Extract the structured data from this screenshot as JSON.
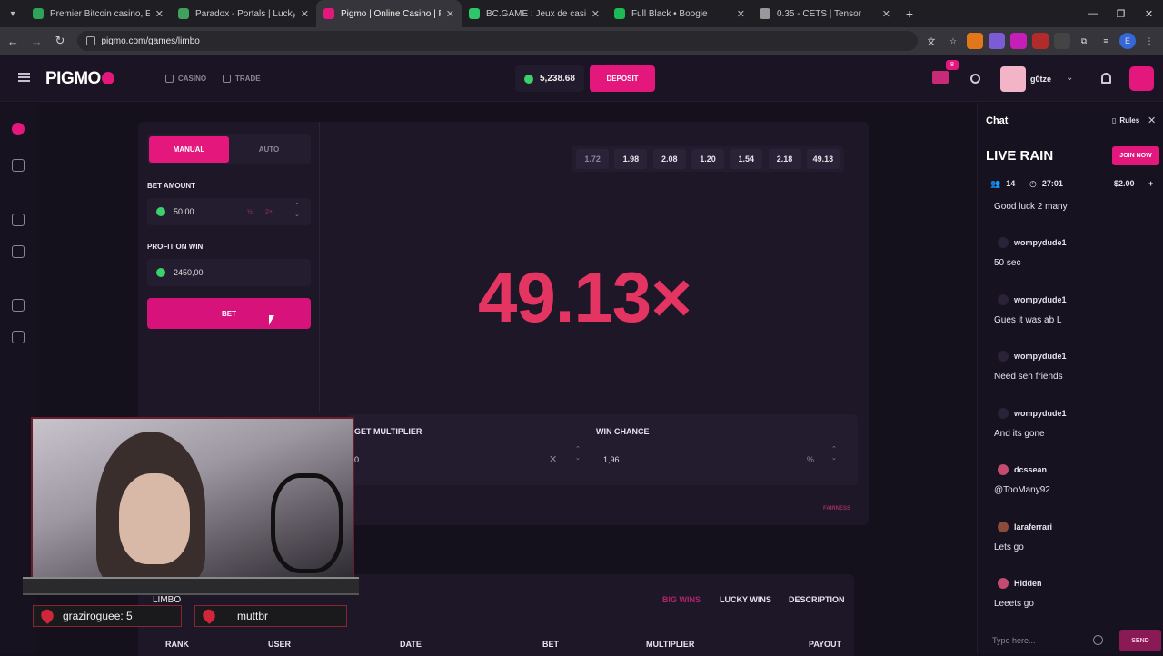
{
  "browser": {
    "tabs": [
      {
        "title": "Premier Bitcoin casino, Ethereu",
        "color": "#2fa35a"
      },
      {
        "title": "Paradox - Portals | LuckySea",
        "color": "#40a05d"
      },
      {
        "title": "Pigmo | Online Casino | Pigmo",
        "color": "#e4177d",
        "active": true
      },
      {
        "title": "BC.GAME : Jeux de casino crypt",
        "color": "#2cc66b"
      },
      {
        "title": "Full Black • Boogie",
        "color": "#1db954"
      },
      {
        "title": "0.35 - CETS | Tensor",
        "color": "#999999"
      }
    ],
    "url": "pigmo.com/games/limbo"
  },
  "header": {
    "logo": "PIGMO",
    "nav": [
      "CASINO",
      "TRADE"
    ],
    "balance": "5,238.68",
    "deposit_label": "DEPOSIT",
    "notif_badge": "8",
    "username": "g0tze"
  },
  "bet_panel": {
    "tab_manual": "MANUAL",
    "tab_auto": "AUTO",
    "bet_amount_label": "BET AMOUNT",
    "bet_amount": "50,00",
    "half": "½",
    "double": "2×",
    "profit_label": "PROFIT ON WIN",
    "profit_value": "2450,00",
    "bet_button": "BET"
  },
  "game": {
    "history": [
      "1.72",
      "1.98",
      "2.08",
      "1.20",
      "1.54",
      "2.18",
      "49.13"
    ],
    "multiplier": "49.13×",
    "target_label": "GET MULTIPLIER",
    "target_value": "0",
    "win_chance_label": "WIN CHANCE",
    "win_chance_value": "1,96",
    "percent": "%",
    "fairness": "FAIRNESS"
  },
  "webcam": {
    "label": "LIMBO",
    "subs": [
      {
        "text": "graziroguee: 5"
      },
      {
        "text": "muttbr"
      }
    ]
  },
  "results": {
    "tabs": [
      "BIG WINS",
      "LUCKY WINS",
      "DESCRIPTION"
    ],
    "columns": [
      "RANK",
      "USER",
      "DATE",
      "BET",
      "MULTIPLIER",
      "PAYOUT"
    ]
  },
  "chat": {
    "title": "Chat",
    "rules": "Rules",
    "rain_title": "LIVE RAIN",
    "join": "JOIN NOW",
    "participants": "14",
    "timer": "27:01",
    "amount": "$2.00",
    "first_message": "Good luck 2 many",
    "messages": [
      {
        "user": "wompydude1",
        "text": "50 sec",
        "av": ""
      },
      {
        "user": "wompydude1",
        "text": "Gues it was ab L",
        "av": ""
      },
      {
        "user": "wompydude1",
        "text": "Need sen friends",
        "av": ""
      },
      {
        "user": "wompydude1",
        "text": "And its gone",
        "av": ""
      },
      {
        "user": "dcssean",
        "text": "@TooMany92",
        "av": "pink"
      },
      {
        "user": "laraferrari",
        "text": "Lets go",
        "av": "brown"
      },
      {
        "user": "Hidden",
        "text": "Leeets go",
        "av": "pink"
      }
    ],
    "input_placeholder": "Type here...",
    "send": "SEND"
  }
}
